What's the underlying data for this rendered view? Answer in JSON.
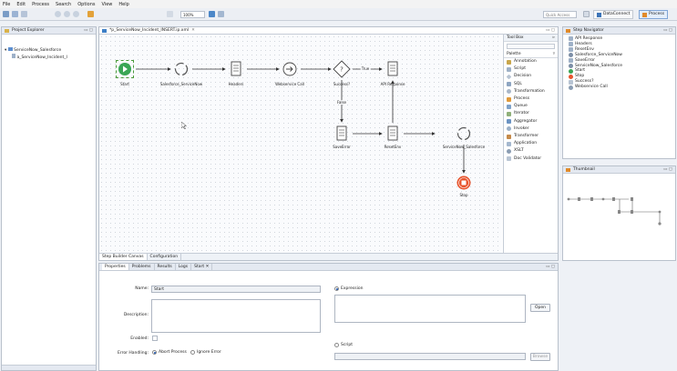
{
  "menu": [
    "File",
    "Edit",
    "Process",
    "Search",
    "Options",
    "View",
    "Help"
  ],
  "toolbar": {
    "zoom_value": "100%",
    "quick_access_placeholder": "Quick Access",
    "perspectives": [
      "DataConnect",
      "Process"
    ]
  },
  "project_explorer": {
    "title": "Project Explorer",
    "tree": [
      {
        "label": "ServiceNow_Salesforce",
        "level": 0
      },
      {
        "label": "a_ServiceNow_Incident_I",
        "level": 1
      }
    ]
  },
  "editor": {
    "tab_title": "*p_ServiceNow_Incident_INSERT.ip.xml",
    "bottom_tabs": [
      "Step Builder Canvas",
      "Configuration"
    ],
    "nodes": {
      "start": "Start",
      "salesforce_servicenow": "Salesforce_ServiceNow",
      "headers": "Headers",
      "webservice_call": "Webservice Call",
      "success": "Success?",
      "api_response": "API Response",
      "true_label": "True",
      "false_label": "False",
      "save_error": "SaveError",
      "reset_env": "ResetEnv",
      "servicenow_salesforce": "ServiceNow_Salesforce",
      "stop": "Stop"
    }
  },
  "toolbox": {
    "title": "Tool Box",
    "palette_title": "Palette",
    "items": [
      "Annotation",
      "Script",
      "Decision",
      "SQL",
      "Transformation",
      "Process",
      "Queue",
      "Iterator",
      "Aggregator",
      "Invoker",
      "Transformer",
      "Application",
      "XSLT",
      "Doc Validator"
    ]
  },
  "step_navigator": {
    "title": "Step Navigator",
    "items": [
      "API Response",
      "Headers",
      "ResetEnv",
      "Salesforce_ServiceNow",
      "SaveError",
      "ServiceNow_Salesforce",
      "Start",
      "Stop",
      "Success?",
      "Webservice Call"
    ]
  },
  "thumbnail": {
    "title": "Thumbnail"
  },
  "properties": {
    "tabs": [
      "Properties",
      "Problems",
      "Results",
      "Logs",
      "Start"
    ],
    "name_label": "Name:",
    "name_value": "Start",
    "description_label": "Description:",
    "enabled_label": "Enabled:",
    "error_handling_label": "Error Handling:",
    "abort_process": "Abort Process",
    "ignore_error": "Ignore Error",
    "expression_label": "Expression",
    "script_label": "Script",
    "open_button": "Open",
    "browse_button": "Browse"
  }
}
